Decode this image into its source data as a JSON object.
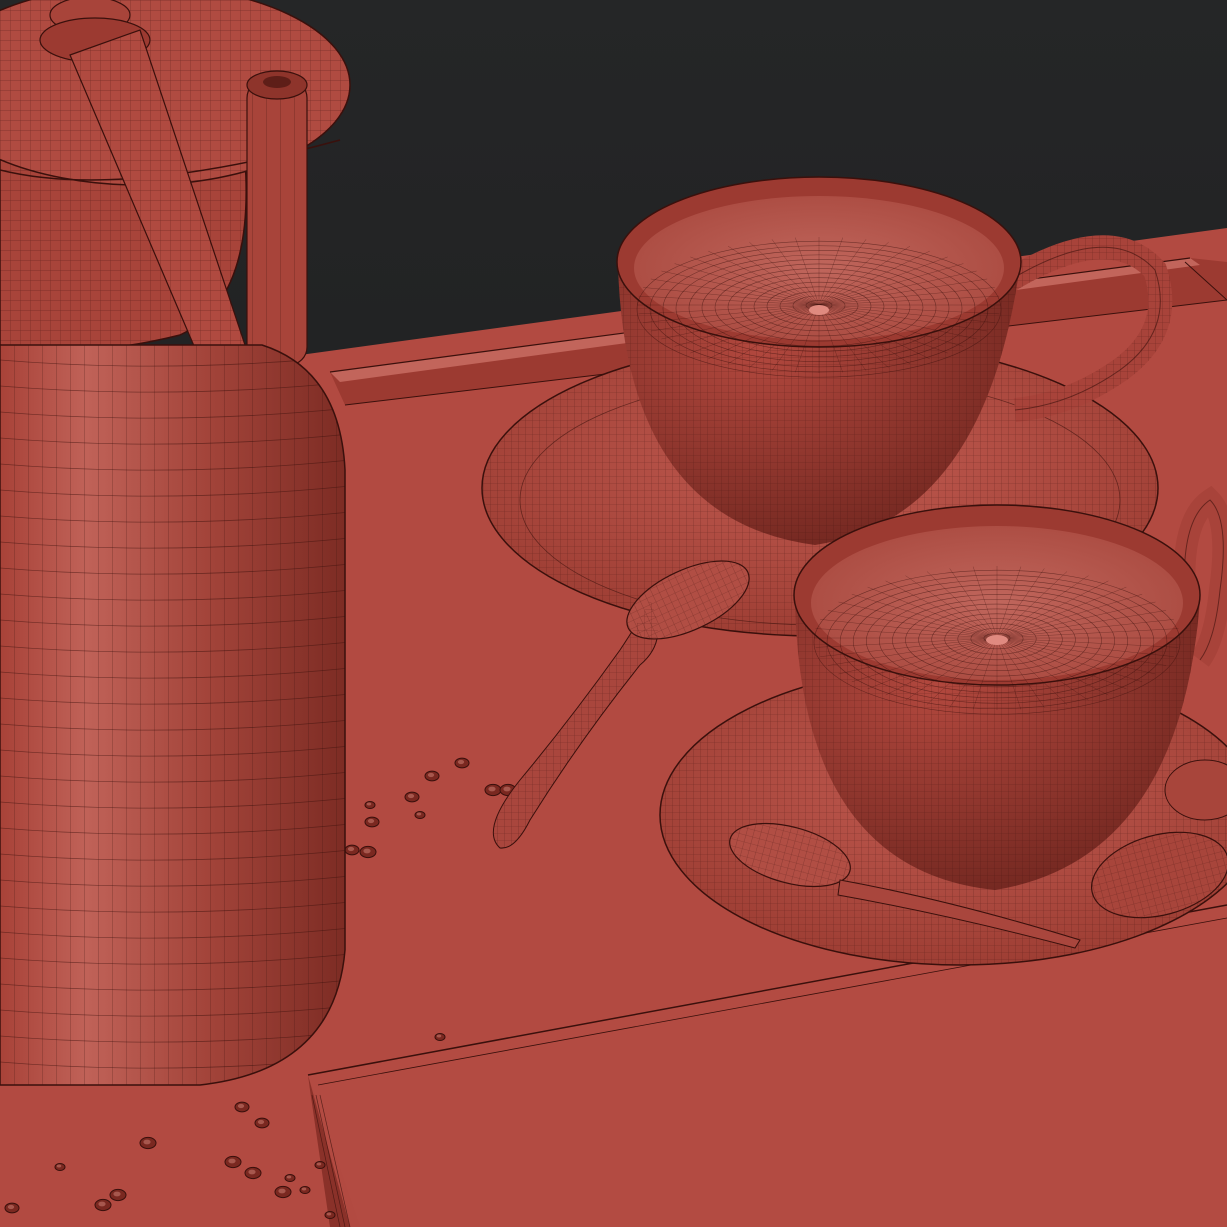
{
  "scene": {
    "subject": "wireframe-render",
    "colors": {
      "background": "#1d1e1f",
      "clay": "#b24c42",
      "clay_dark": "#8a3129",
      "clay_shadow": "#5e1e18",
      "clay_light": "#c8685e",
      "wire": "#3a100c"
    }
  }
}
